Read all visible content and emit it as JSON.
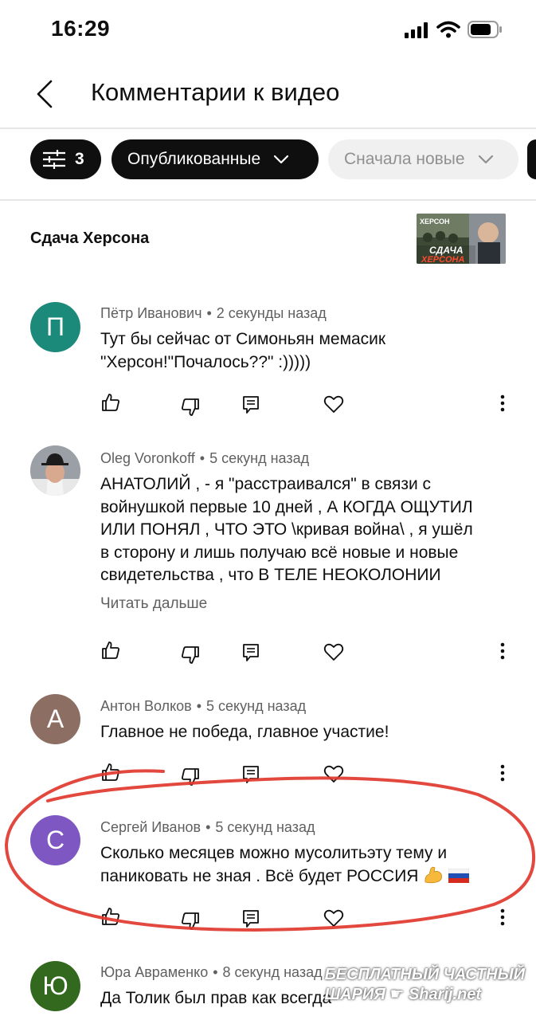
{
  "status": {
    "time": "16:29"
  },
  "header": {
    "title": "Комментарии к видео"
  },
  "filters": {
    "count": "3",
    "published": "Опубликованные",
    "sort": "Сначала новые"
  },
  "video": {
    "title": "Сдача Херсона",
    "thumb_caption_top": "ХЕРСОН",
    "thumb_caption_1": "СДАЧА",
    "thumb_caption_2": "ХЕРСОНА"
  },
  "comments": [
    {
      "avatar_letter": "П",
      "avatar_color": "#1b8a7a",
      "author": "Пётр Иванович",
      "time": "2 секунды назад",
      "lines": [
        "Тут бы сейчас от Симоньян мемасик",
        "\"Херсон!\"Почалось??\" :)))))"
      ]
    },
    {
      "avatar_letter": "",
      "author": "Oleg Voronkoff",
      "time": "5 секунд назад",
      "lines": [
        "АНАТОЛИЙ , - я \"расстраивался\" в связи с",
        "войнушкой первые 10 дней , А КОГДА ОЩУТИЛ",
        "ИЛИ ПОНЯЛ , ЧТО ЭТО \\кривая война\\ , я ушёл",
        "в сторону и лишь получаю всё новые и новые",
        "свидетельства , что В ТЕЛЕ НЕОКОЛОНИИ"
      ],
      "read_more": "Читать дальше"
    },
    {
      "avatar_letter": "А",
      "avatar_color": "#8d6e63",
      "author": "Антон Волков",
      "time": "5 секунд назад",
      "lines": [
        "Главное не победа, главное участие!"
      ]
    },
    {
      "avatar_letter": "С",
      "avatar_color": "#7e57c2",
      "author": "Сергей Иванов",
      "time": "5 секунд назад",
      "lines": [
        "Сколько месяцев можно мусолитьэту тему и",
        "паниковать не зная . Всё будет РОССИЯ"
      ]
    },
    {
      "avatar_letter": "Ю",
      "avatar_color": "#33691e",
      "author": "Юра Авраменко",
      "time": "8 секунд назад",
      "lines": [
        "Да Толик был прав как всегда"
      ]
    }
  ],
  "watermark": {
    "line1": "БЕСПЛАТНЫЙ ЧАСТНЫЙ",
    "line2": "ШАРИЯ",
    "line3": "Sharij.net"
  },
  "annotation_color": "#e0382e"
}
